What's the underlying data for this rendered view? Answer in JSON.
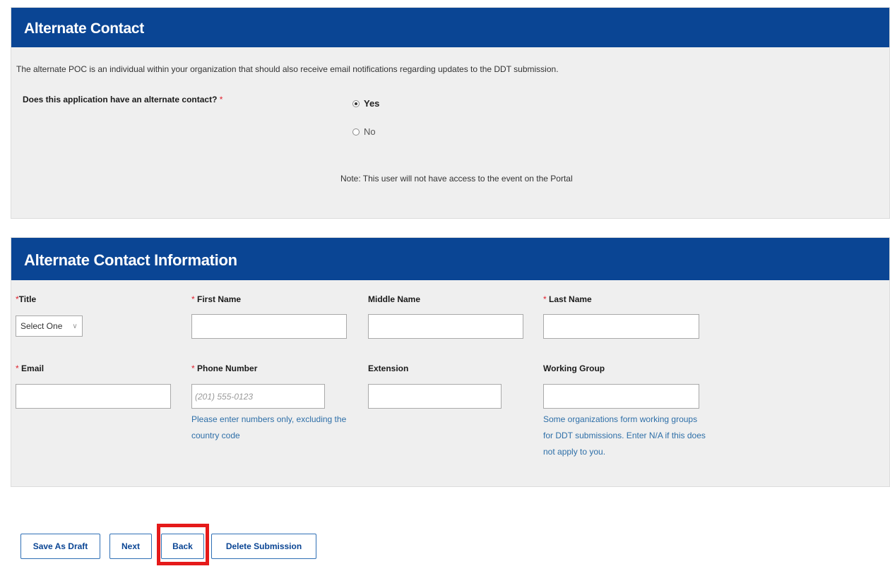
{
  "section1": {
    "title": "Alternate Contact",
    "description": "The alternate POC is an individual within your organization that should also receive email notifications regarding updates to the DDT submission.",
    "question": "Does this application have an alternate contact?",
    "required_marker": "*",
    "options": [
      {
        "label": "Yes",
        "checked": true
      },
      {
        "label": "No",
        "checked": false
      }
    ],
    "note": "Note: This user will not have access to the event on the Portal"
  },
  "section2": {
    "title": "Alternate Contact Information",
    "fields": {
      "title": {
        "label": "Title",
        "required": true,
        "value": "Select One"
      },
      "first_name": {
        "label": "First Name",
        "required": true,
        "value": ""
      },
      "middle_name": {
        "label": "Middle Name",
        "required": false,
        "value": ""
      },
      "last_name": {
        "label": "Last Name",
        "required": true,
        "value": ""
      },
      "email": {
        "label": "Email",
        "required": true,
        "value": ""
      },
      "phone": {
        "label": "Phone Number",
        "required": true,
        "value": "",
        "placeholder": "(201) 555-0123",
        "help": [
          "Please enter numbers only, excluding the",
          "country code"
        ]
      },
      "extension": {
        "label": "Extension",
        "required": false,
        "value": ""
      },
      "working_group": {
        "label": "Working Group",
        "required": false,
        "value": "",
        "help": [
          "Some organizations form working groups",
          "for DDT submissions. Enter N/A if this does",
          "not apply to you."
        ]
      }
    }
  },
  "buttons": {
    "save_draft": "Save As Draft",
    "next": "Next",
    "back": "Back",
    "delete": "Delete Submission"
  },
  "colors": {
    "header_bg": "#0a4594",
    "section_bg": "#efefef",
    "required": "#e0202d",
    "help_text": "#2e6fa8",
    "highlight": "#e51a1a"
  }
}
